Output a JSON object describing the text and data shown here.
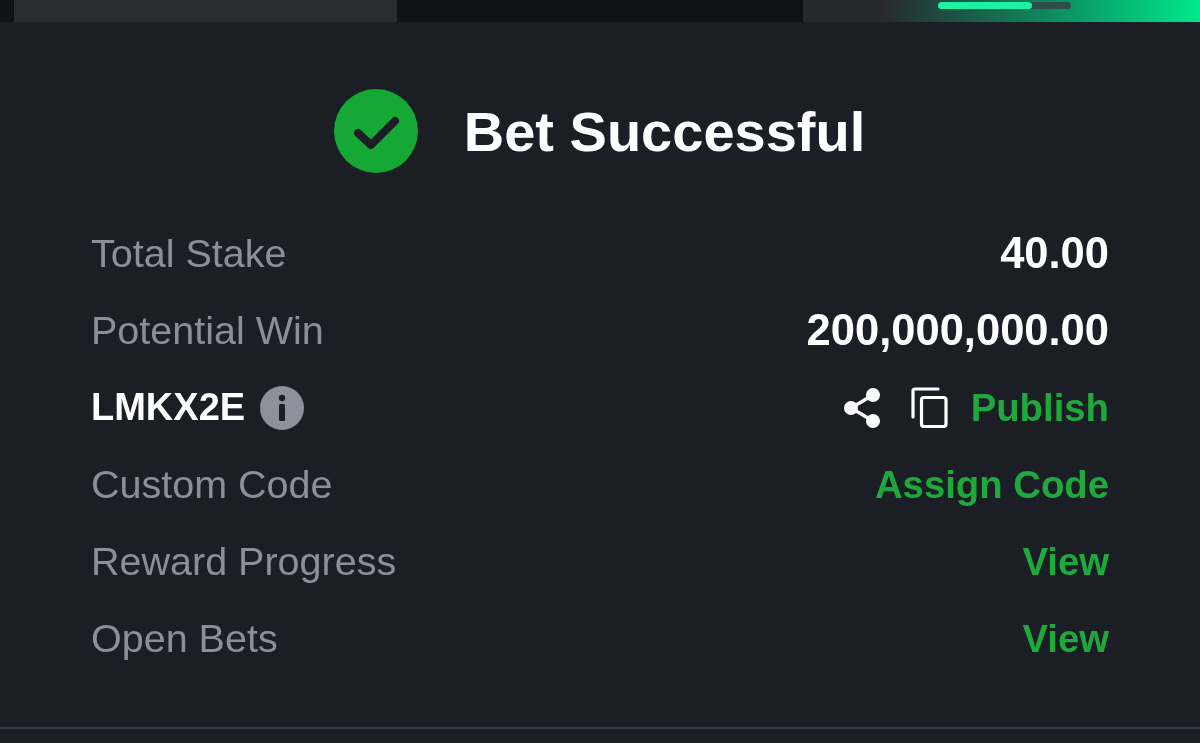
{
  "tabs": [
    {
      "selected": false
    },
    {
      "selected": true
    },
    {
      "selected": false,
      "boost_progress": {
        "level": 0.71
      }
    }
  ],
  "result": {
    "kind": "success",
    "title": "Bet Successful"
  },
  "rows": [
    {
      "kind": "amount",
      "label": "Total Stake",
      "value": "40.00"
    },
    {
      "kind": "amount",
      "label": "Potential Win",
      "value": "200,000,000.00"
    },
    {
      "kind": "booking_code",
      "label": "LMKX2E",
      "action": "Publish"
    },
    {
      "kind": "link",
      "label": "Custom Code",
      "action": "Assign Code"
    },
    {
      "kind": "link",
      "label": "Reward Progress",
      "action": "View"
    },
    {
      "kind": "link",
      "label": "Open Bets",
      "action": "View"
    }
  ]
}
